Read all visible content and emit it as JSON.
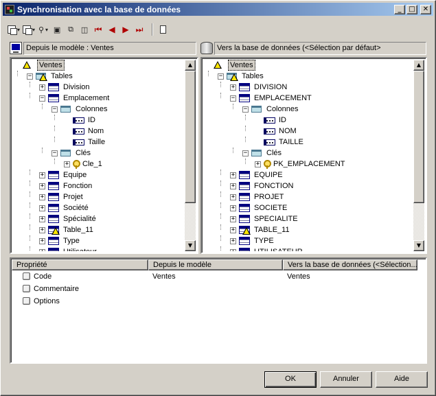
{
  "window": {
    "title": "Synchronisation avec la base de données"
  },
  "title_buttons": {
    "minimize": "_",
    "maximize": "□",
    "close": "✕"
  },
  "toolbar": {
    "dropdown_glyph": "▾",
    "nav_first": "⏮",
    "nav_prev": "◀",
    "nav_next": "▶",
    "nav_last": "⏭"
  },
  "left_panel": {
    "header": "Depuis le modèle : Ventes"
  },
  "right_panel": {
    "header": "Vers la base de données (<Sélection par défaut>"
  },
  "left_tree": [
    {
      "label": "Ventes",
      "depth": 0,
      "icon": "warn",
      "expander": "",
      "selected": true
    },
    {
      "label": "Tables",
      "depth": 1,
      "icon": "warn-folder",
      "expander": "−"
    },
    {
      "label": "Division",
      "depth": 2,
      "icon": "table",
      "expander": "+"
    },
    {
      "label": "Emplacement",
      "depth": 2,
      "icon": "table",
      "expander": "−"
    },
    {
      "label": "Colonnes",
      "depth": 3,
      "icon": "folder",
      "expander": "−"
    },
    {
      "label": "ID",
      "depth": 4,
      "icon": "column",
      "expander": ""
    },
    {
      "label": "Nom",
      "depth": 4,
      "icon": "column",
      "expander": ""
    },
    {
      "label": "Taille",
      "depth": 4,
      "icon": "column",
      "expander": ""
    },
    {
      "label": "Clés",
      "depth": 3,
      "icon": "folder",
      "expander": "−"
    },
    {
      "label": "Cle_1",
      "depth": 4,
      "icon": "key",
      "expander": "+"
    },
    {
      "label": "Equipe",
      "depth": 2,
      "icon": "table",
      "expander": "+"
    },
    {
      "label": "Fonction",
      "depth": 2,
      "icon": "table",
      "expander": "+"
    },
    {
      "label": "Projet",
      "depth": 2,
      "icon": "table",
      "expander": "+"
    },
    {
      "label": "Société",
      "depth": 2,
      "icon": "table",
      "expander": "+"
    },
    {
      "label": "Spécialité",
      "depth": 2,
      "icon": "table",
      "expander": "+"
    },
    {
      "label": "Table_11",
      "depth": 2,
      "icon": "warn-table",
      "expander": "+"
    },
    {
      "label": "Type",
      "depth": 2,
      "icon": "table",
      "expander": "+"
    },
    {
      "label": "Utilisateur",
      "depth": 2,
      "icon": "table",
      "expander": "+"
    }
  ],
  "right_tree": [
    {
      "label": "Ventes",
      "depth": 0,
      "icon": "warn",
      "expander": "",
      "selected": true
    },
    {
      "label": "Tables",
      "depth": 1,
      "icon": "warn-folder",
      "expander": "−"
    },
    {
      "label": "DIVISION",
      "depth": 2,
      "icon": "table",
      "expander": "+"
    },
    {
      "label": "EMPLACEMENT",
      "depth": 2,
      "icon": "table",
      "expander": "−"
    },
    {
      "label": "Colonnes",
      "depth": 3,
      "icon": "folder",
      "expander": "−"
    },
    {
      "label": "ID",
      "depth": 4,
      "icon": "column",
      "expander": ""
    },
    {
      "label": "NOM",
      "depth": 4,
      "icon": "column",
      "expander": ""
    },
    {
      "label": "TAILLE",
      "depth": 4,
      "icon": "column",
      "expander": ""
    },
    {
      "label": "Clés",
      "depth": 3,
      "icon": "folder",
      "expander": "−"
    },
    {
      "label": "PK_EMPLACEMENT",
      "depth": 4,
      "icon": "key",
      "expander": "+"
    },
    {
      "label": "EQUIPE",
      "depth": 2,
      "icon": "table",
      "expander": "+"
    },
    {
      "label": "FONCTION",
      "depth": 2,
      "icon": "table",
      "expander": "+"
    },
    {
      "label": "PROJET",
      "depth": 2,
      "icon": "table",
      "expander": "+"
    },
    {
      "label": "SOCIETE",
      "depth": 2,
      "icon": "table",
      "expander": "+"
    },
    {
      "label": "SPECIALITE",
      "depth": 2,
      "icon": "table",
      "expander": "+"
    },
    {
      "label": "TABLE_11",
      "depth": 2,
      "icon": "warn-table",
      "expander": "+"
    },
    {
      "label": "TYPE",
      "depth": 2,
      "icon": "table",
      "expander": "+"
    },
    {
      "label": "UTILISATEUR",
      "depth": 2,
      "icon": "table",
      "expander": "+"
    }
  ],
  "scrollbar_glyphs": {
    "up": "▲",
    "down": "▼"
  },
  "properties": {
    "columns": [
      "Propriété",
      "Depuis le modèle",
      "Vers la base de données (<Sélection..."
    ],
    "rows": [
      [
        "Code",
        "Ventes",
        "Ventes"
      ],
      [
        "Commentaire",
        "",
        ""
      ],
      [
        "Options",
        "",
        ""
      ]
    ]
  },
  "buttons": {
    "ok": "OK",
    "cancel": "Annuler",
    "help": "Aide"
  }
}
